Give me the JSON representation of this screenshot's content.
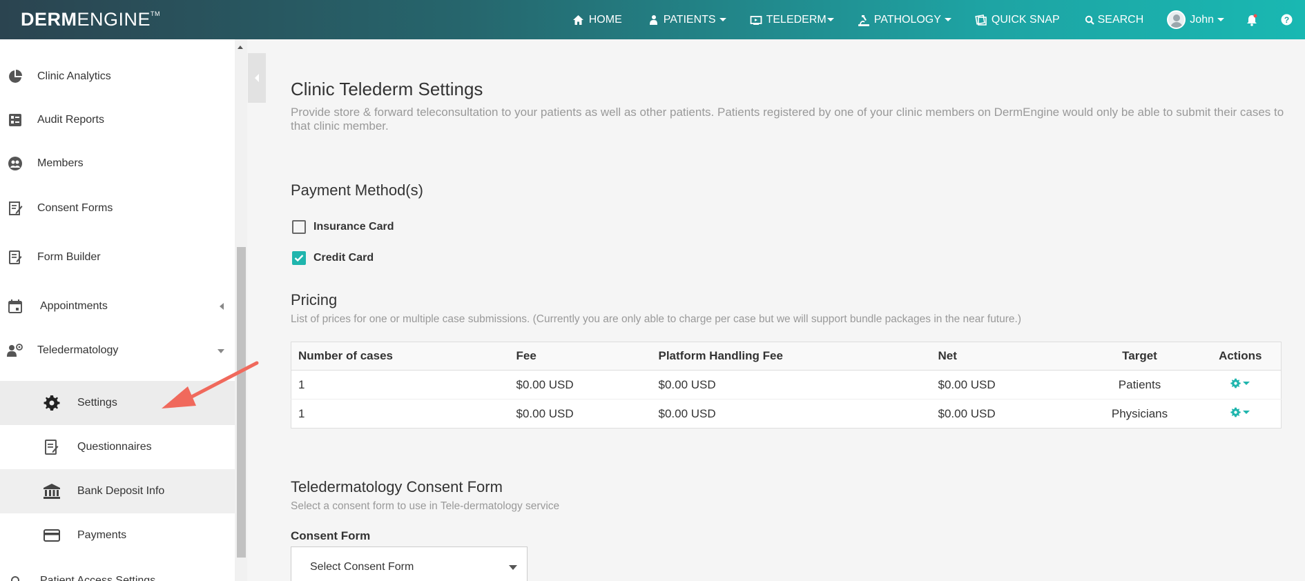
{
  "header": {
    "logo_bold": "DERM",
    "logo_light": "ENGINE",
    "logo_tm": "TM",
    "nav": {
      "home": "HOME",
      "patients": "PATIENTS",
      "telederm": "TELEDERM",
      "pathology": "PATHOLOGY",
      "quick_snap": "QUICK SNAP",
      "search": "SEARCH",
      "user": "John"
    }
  },
  "sidebar": {
    "items": [
      {
        "label": "Clinic Analytics",
        "icon": "pie-chart-icon"
      },
      {
        "label": "Audit Reports",
        "icon": "report-icon"
      },
      {
        "label": "Members",
        "icon": "members-icon"
      },
      {
        "label": "Consent Forms",
        "icon": "consent-icon"
      },
      {
        "label": "Form Builder",
        "icon": "form-builder-icon"
      },
      {
        "label": "Appointments",
        "icon": "calendar-icon"
      },
      {
        "label": "Teledermatology",
        "icon": "telederm-icon"
      }
    ],
    "sub_items": [
      {
        "label": "Settings",
        "icon": "gear-icon"
      },
      {
        "label": "Questionnaires",
        "icon": "questionnaire-icon"
      },
      {
        "label": "Bank Deposit Info",
        "icon": "bank-icon"
      },
      {
        "label": "Payments",
        "icon": "credit-card-icon"
      }
    ],
    "cut_item": "Patient Access Settings"
  },
  "main": {
    "title": "Clinic Telederm Settings",
    "description": "Provide store & forward teleconsultation to your patients as well as other patients. Patients registered by one of your clinic members on DermEngine would only be able to submit their cases to that clinic member.",
    "payment": {
      "heading": "Payment Method(s)",
      "options": [
        {
          "label": "Insurance Card",
          "checked": false
        },
        {
          "label": "Credit Card",
          "checked": true
        }
      ]
    },
    "pricing": {
      "heading": "Pricing",
      "description": "List of prices for one or multiple case submissions. (Currently you are only able to charge per case but we will support bundle packages in the near future.)",
      "columns": [
        "Number of cases",
        "Fee",
        "Platform Handling Fee",
        "Net",
        "Target",
        "Actions"
      ],
      "rows": [
        [
          "1",
          "$0.00 USD",
          "$0.00 USD",
          "$0.00 USD",
          "Patients"
        ],
        [
          "1",
          "$0.00 USD",
          "$0.00 USD",
          "$0.00 USD",
          "Physicians"
        ]
      ]
    },
    "consent": {
      "heading": "Teledermatology Consent Form",
      "description": "Select a consent form to use in Tele-dermatology service",
      "field_label": "Consent Form",
      "select_value": "Select Consent Form"
    }
  },
  "colors": {
    "accent": "#1fb5ad",
    "annotation_arrow": "#f0695c"
  }
}
